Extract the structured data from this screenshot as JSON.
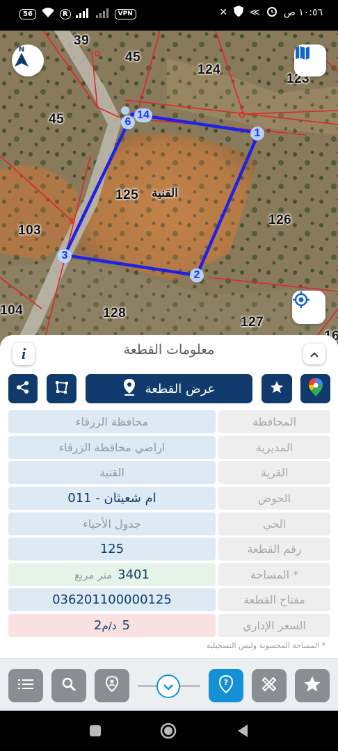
{
  "status_bar": {
    "data_badge": "56",
    "roaming_badge": "R",
    "vpn_badge": "VPN",
    "time": "١٠:٥٦ ص"
  },
  "map": {
    "parcel_labels": [
      "39",
      "45",
      "124",
      "123",
      "45",
      "125",
      "126",
      "103",
      "104",
      "128",
      "127",
      "16"
    ],
    "village_name": "القنية",
    "corner_labels": [
      "1",
      "2",
      "3",
      "6",
      "14"
    ],
    "colors": {
      "parcel_outline": "#1f22e6",
      "boundary_lines": "#e0262a"
    }
  },
  "panel": {
    "title": "معلومات القطعة",
    "info_label": "i",
    "show_parcel_label": "عرض القطعة",
    "rows": [
      {
        "label": "المحافظة",
        "value": "محافظة الزرقاء"
      },
      {
        "label": "المديرية",
        "value": "اراضي محافظة الزرقاء"
      },
      {
        "label": "القرية",
        "value": "القنية"
      },
      {
        "label": "الحوض",
        "value": "ام شعيثان - 011"
      },
      {
        "label": "الحي",
        "value": "جدول الأحياء"
      },
      {
        "label": "رقم القطعة",
        "value": "125"
      },
      {
        "label": "المساحة *",
        "value": "3401",
        "unit": "متر مربع"
      },
      {
        "label": "مفتاح القطعة",
        "value": "036201100000125"
      },
      {
        "label": "السعر الإداري",
        "value": "5",
        "unit_prefix": "د/م",
        "unit_sup": "2"
      }
    ],
    "note": "* المساحة المحسوبة وليس التسجيلية"
  }
}
